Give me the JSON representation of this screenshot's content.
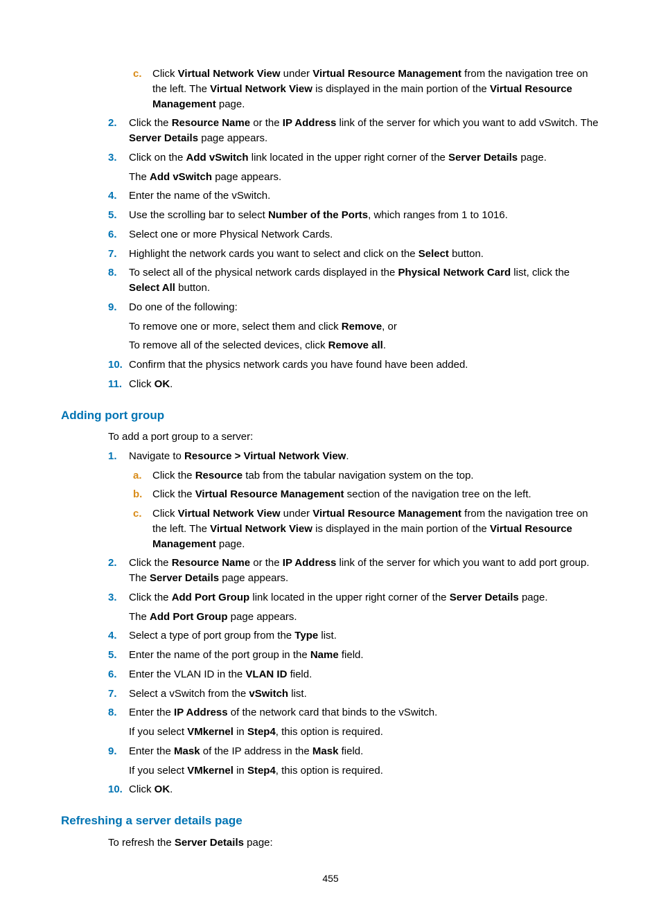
{
  "s1": {
    "c_pre": "Click ",
    "c_b1": "Virtual Network View",
    "c_mid1": " under ",
    "c_b2": "Virtual Resource Management",
    "c_mid2": " from the navigation tree on the left. The ",
    "c_b3": "Virtual Network View",
    "c_mid3": " is displayed in the main portion of the ",
    "c_b4": "Virtual Resource Management",
    "c_tail": " page.",
    "n2_a": "Click the ",
    "n2_b1": "Resource Name",
    "n2_b": " or the ",
    "n2_b2": "IP Address",
    "n2_c": " link of the server for which you want to add vSwitch. The ",
    "n2_b3": "Server Details",
    "n2_d": " page appears.",
    "n3_a": "Click on the ",
    "n3_b1": "Add vSwitch",
    "n3_b": " link located in the upper right corner of the ",
    "n3_b2": "Server Details",
    "n3_c": " page.",
    "n3_sub_a": "The ",
    "n3_sub_b": "Add vSwitch",
    "n3_sub_c": " page appears.",
    "n4": "Enter the name of the vSwitch.",
    "n5_a": "Use the scrolling bar to select ",
    "n5_b1": "Number of the Ports",
    "n5_b": ", which ranges from 1 to 1016.",
    "n6": "Select one or more Physical Network Cards.",
    "n7_a": "Highlight the network cards you want to select and click on the ",
    "n7_b1": "Select",
    "n7_b": " button.",
    "n8_a": "To select all of the physical network cards displayed in the ",
    "n8_b1": "Physical Network Card",
    "n8_b": " list, click the ",
    "n8_b2": "Select All",
    "n8_c": " button.",
    "n9": "Do one of the following:",
    "n9_s1a": "To remove one or more, select them and click ",
    "n9_s1b": "Remove",
    "n9_s1c": ", or",
    "n9_s2a": "To remove all of the selected devices, click ",
    "n9_s2b": "Remove all",
    "n9_s2c": ".",
    "n10": "Confirm that the physics network cards you have found have been added.",
    "n11_a": "Click ",
    "n11_b": "OK",
    "n11_c": "."
  },
  "h1": "Adding port group",
  "s2": {
    "intro": "To add a port group to a server:",
    "n1_a": "Navigate to ",
    "n1_b": "Resource > Virtual Network View",
    "n1_c": ".",
    "a_a": "Click the ",
    "a_b": "Resource",
    "a_c": " tab from the tabular navigation system on the top.",
    "b_a": "Click the ",
    "b_b": "Virtual Resource Management",
    "b_c": " section of the navigation tree on the left.",
    "n2_a": "Click the ",
    "n2_b1": "Resource Name",
    "n2_b": " or the ",
    "n2_b2": "IP Address",
    "n2_c": " link of the server for which you want to add port group. The ",
    "n2_b3": "Server Details",
    "n2_d": " page appears.",
    "n3_a": "Click the ",
    "n3_b1": "Add Port Group",
    "n3_b": " link located in the upper right corner of the ",
    "n3_b2": "Server Details",
    "n3_c": " page.",
    "n3_sub_a": "The ",
    "n3_sub_b": "Add Port Group",
    "n3_sub_c": " page appears.",
    "n4_a": "Select a type of port group from the ",
    "n4_b": "Type",
    "n4_c": " list.",
    "n5_a": "Enter the name of the port group in the ",
    "n5_b": "Name",
    "n5_c": " field.",
    "n6_a": "Enter the VLAN ID in the ",
    "n6_b": "VLAN ID",
    "n6_c": " field.",
    "n7_a": "Select a vSwitch from the ",
    "n7_b": "vSwitch",
    "n7_c": " list.",
    "n8_a": "Enter the ",
    "n8_b": "IP Address",
    "n8_c": " of the network card that binds to the vSwitch.",
    "n8_sub_a": "If you select ",
    "n8_sub_b": "VMkernel",
    "n8_sub_c": " in ",
    "n8_sub_d": "Step4",
    "n8_sub_e": ", this option is required.",
    "n9_a": "Enter the ",
    "n9_b": "Mask",
    "n9_c": " of the IP address in the ",
    "n9_d": "Mask",
    "n9_e": " field.",
    "n9_sub_a": "If you select ",
    "n9_sub_b": "VMkernel",
    "n9_sub_c": " in ",
    "n9_sub_d": "Step4",
    "n9_sub_e": ", this option is required.",
    "n10_a": "Click ",
    "n10_b": "OK",
    "n10_c": "."
  },
  "h2": "Refreshing a server details page",
  "s3": {
    "intro_a": "To refresh the ",
    "intro_b": "Server Details",
    "intro_c": " page:"
  },
  "page": "455",
  "markers": {
    "c": "c.",
    "a": "a.",
    "b": "b.",
    "m2": "2.",
    "m3": "3.",
    "m4": "4.",
    "m5": "5.",
    "m6": "6.",
    "m7": "7.",
    "m8": "8.",
    "m9": "9.",
    "m10": "10.",
    "m11": "11.",
    "m1": "1."
  }
}
